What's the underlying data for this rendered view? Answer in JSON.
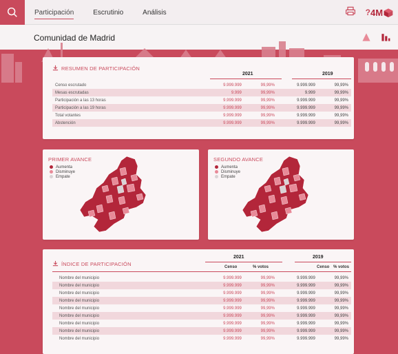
{
  "nav": {
    "tabs": [
      {
        "label": "Participación",
        "active": true
      },
      {
        "label": "Escrutinio",
        "active": false
      },
      {
        "label": "Análisis",
        "active": false
      }
    ],
    "help": "?",
    "logo": "4M"
  },
  "header": {
    "title": "Comunidad de Madrid"
  },
  "resumen": {
    "title": "RESUMEN DE PARTICIPACIÓN",
    "years": [
      "2021",
      "2019"
    ],
    "rows": [
      {
        "label": "Censo escrutado",
        "v1": "9.999.999",
        "p1": "99,99%",
        "v2": "9.999.999",
        "p2": "99,99%"
      },
      {
        "label": "Mesas escrutadas",
        "v1": "9.999",
        "p1": "99,99%",
        "v2": "9.999",
        "p2": "99,99%"
      },
      {
        "label": "Participación a las 13 horas",
        "v1": "9.999.999",
        "p1": "99,99%",
        "v2": "9.999.999",
        "p2": "99,99%"
      },
      {
        "label": "Participación a las 19 horas",
        "v1": "9.999.999",
        "p1": "99,99%",
        "v2": "9.999.999",
        "p2": "99,99%"
      },
      {
        "label": "Total votantes",
        "v1": "9.999.999",
        "p1": "99,99%",
        "v2": "9.999.999",
        "p2": "99,99%"
      },
      {
        "label": "Abstención",
        "v1": "9.999.999",
        "p1": "99,99%",
        "v2": "9.999.999",
        "p2": "99,99%"
      }
    ]
  },
  "avance1": {
    "title": "PRIMER AVANCE"
  },
  "avance2": {
    "title": "SEGUNDO AVANCE"
  },
  "legend": {
    "items": [
      {
        "label": "Aumenta",
        "color": "#b3263a"
      },
      {
        "label": "Disminuye",
        "color": "#e88a98"
      },
      {
        "label": "Empate",
        "color": "#d9d3d5"
      }
    ]
  },
  "indice": {
    "title": "ÍNDICE DE PARTICIPACIÓN",
    "years": [
      "2021",
      "2019"
    ],
    "col_censo": "Censo",
    "col_votos": "% votos",
    "rows": [
      {
        "label": "Nombre del municipio",
        "v1": "9.999.999",
        "p1": "99,99%",
        "v2": "9.999.999",
        "p2": "99,99%"
      },
      {
        "label": "Nombre del municipio",
        "v1": "9.999.999",
        "p1": "99,99%",
        "v2": "9.999.999",
        "p2": "99,99%"
      },
      {
        "label": "Nombre del municipio",
        "v1": "9.999.999",
        "p1": "99,99%",
        "v2": "9.999.999",
        "p2": "99,99%"
      },
      {
        "label": "Nombre del municipio",
        "v1": "9.999.999",
        "p1": "99,99%",
        "v2": "9.999.999",
        "p2": "99,99%"
      },
      {
        "label": "Nombre del municipio",
        "v1": "9.999.999",
        "p1": "99,99%",
        "v2": "9.999.999",
        "p2": "99,99%"
      },
      {
        "label": "Nombre del municipio",
        "v1": "9.999.999",
        "p1": "99,99%",
        "v2": "9.999.999",
        "p2": "99,99%"
      },
      {
        "label": "Nombre del municipio",
        "v1": "9.999.999",
        "p1": "99,99%",
        "v2": "9.999.999",
        "p2": "99,99%"
      },
      {
        "label": "Nombre del municipio",
        "v1": "9.999.999",
        "p1": "99,99%",
        "v2": "9.999.999",
        "p2": "99,99%"
      },
      {
        "label": "Nombre del municipio",
        "v1": "9.999.999",
        "p1": "99,99%",
        "v2": "9.999.999",
        "p2": "99,99%"
      }
    ]
  },
  "colors": {
    "accent": "#c94a5c",
    "dark": "#b3263a",
    "light": "#e88a98",
    "neutral": "#d9d3d5"
  }
}
